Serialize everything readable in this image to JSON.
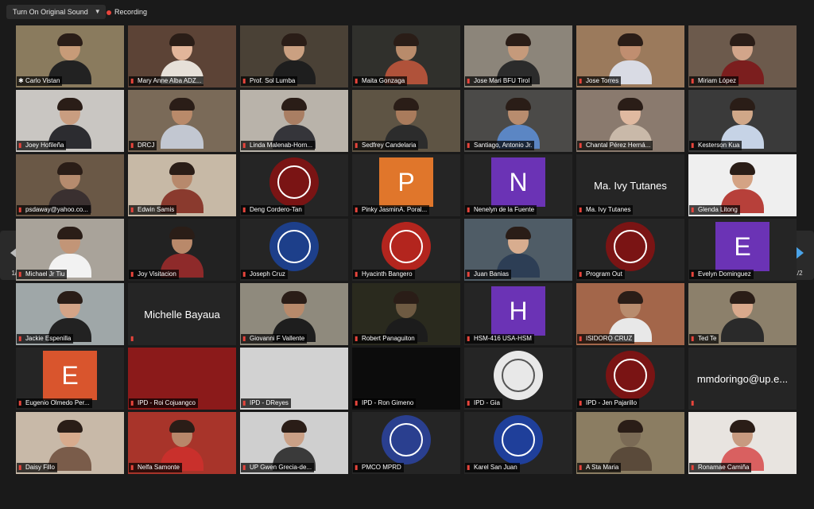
{
  "toolbar": {
    "sound_button": "Turn On Original Sound",
    "recording": "Recording"
  },
  "pager": {
    "left_page": "1/2",
    "right_page": "1/2"
  },
  "participants": [
    {
      "name": "Carlo Vistan",
      "kind": "video",
      "bg": "#8a7b5e",
      "skin": "#c79b78",
      "shirt": "#222",
      "active": true,
      "pinned": true
    },
    {
      "name": "Mary Anne Alba ADZ...",
      "kind": "video",
      "bg": "#5c4336",
      "skin": "#e2b59a",
      "shirt": "#e6e0d8"
    },
    {
      "name": "Prof. Sol Lumba",
      "kind": "video",
      "bg": "#4a4136",
      "skin": "#caa081",
      "shirt": "#1e1e1e"
    },
    {
      "name": "Maita Gonzaga",
      "kind": "video",
      "bg": "#30302c",
      "skin": "#b88b6b",
      "shirt": "#b0523a"
    },
    {
      "name": "Jose Mari BFU Tirol",
      "kind": "video",
      "bg": "#8c857a",
      "skin": "#c59a7b",
      "shirt": "#2b2b2b"
    },
    {
      "name": "Jose Torres",
      "kind": "video",
      "bg": "#9b7a5c",
      "skin": "#c08e70",
      "shirt": "#d9dbe4"
    },
    {
      "name": "Miriam López",
      "kind": "video",
      "bg": "#6c5a4c",
      "skin": "#d2a58a",
      "shirt": "#7b1e1e"
    },
    {
      "name": "Joey Hofileña",
      "kind": "video",
      "bg": "#c9c6c2",
      "skin": "#c99d80",
      "shirt": "#2c2c30"
    },
    {
      "name": "DRCJ",
      "kind": "video",
      "bg": "#7a6a58",
      "skin": "#b98a6a",
      "shirt": "#c2c7d1"
    },
    {
      "name": "Linda Malenab-Horn...",
      "kind": "video",
      "bg": "#b9b3aa",
      "skin": "#a97e63",
      "shirt": "#35353a"
    },
    {
      "name": "Sedfrey Candelaria",
      "kind": "video",
      "bg": "#5e5444",
      "skin": "#a97b5c",
      "shirt": "#2c2c2c"
    },
    {
      "name": "Santiago, Antonio Jr.",
      "kind": "video",
      "bg": "#4b4a48",
      "skin": "#b88c6e",
      "shirt": "#5b86c4"
    },
    {
      "name": "Chantal Pérez  Herná...",
      "kind": "video",
      "bg": "#8a7a6e",
      "skin": "#e0b9a0",
      "shirt": "#c9b9a9"
    },
    {
      "name": "Kesterson Kua",
      "kind": "video",
      "bg": "#3a3a3a",
      "skin": "#d0a788",
      "shirt": "#c6d3e6"
    },
    {
      "name": "psdaway@yahoo.co...",
      "kind": "video",
      "bg": "#6a5846",
      "skin": "#b58b6e",
      "shirt": "#3a3030"
    },
    {
      "name": "Edwin Samis",
      "kind": "video",
      "bg": "#c7b9a6",
      "skin": "#b7896c",
      "shirt": "#8a3a2e"
    },
    {
      "name": "Deng Cordero-Tan",
      "kind": "seal",
      "seal": "#7a1414"
    },
    {
      "name": "Pinky JasminA. Poral...",
      "kind": "letter",
      "letter": "P",
      "color": "#e0762b"
    },
    {
      "name": "Nenelyn de la Fuente",
      "kind": "letter",
      "letter": "N",
      "color": "#6b33b5"
    },
    {
      "name": "Ma. Ivy Tutanes",
      "kind": "name",
      "display": "Ma. Ivy Tutanes"
    },
    {
      "name": "Glenda Litong",
      "kind": "video",
      "bg": "#efefef",
      "skin": "#d4a384",
      "shirt": "#b7403a"
    },
    {
      "name": "Michael Jr Tiu",
      "kind": "video",
      "bg": "#a9a39a",
      "skin": "#c29577",
      "shirt": "#f2f2f2"
    },
    {
      "name": "Joy Visitacion",
      "kind": "video",
      "bg": "#222",
      "skin": "#b9896a",
      "shirt": "#8e2a2a"
    },
    {
      "name": "Joseph Cruz",
      "kind": "seal",
      "seal": "#1d3f8a"
    },
    {
      "name": "Hyacinth Bangero",
      "kind": "seal",
      "seal": "#b3251e"
    },
    {
      "name": "Juan Banias",
      "kind": "video",
      "bg": "#4f5c66",
      "skin": "#d8ad8f",
      "shirt": "#2d3e55"
    },
    {
      "name": "Program Out",
      "kind": "seal",
      "seal": "#7a1414"
    },
    {
      "name": "Evelyn Dominguez",
      "kind": "letter",
      "letter": "E",
      "color": "#6b33b5"
    },
    {
      "name": "Jackie Espenilla",
      "kind": "video",
      "bg": "#9fa7a8",
      "skin": "#d4a487",
      "shirt": "#222"
    },
    {
      "name": "Michelle Bayaua",
      "kind": "name",
      "display": "Michelle Bayaua",
      "nolabel": true
    },
    {
      "name": "Giovanni F Vallente",
      "kind": "video",
      "bg": "#8f8a7d",
      "skin": "#b88a6b",
      "shirt": "#1e1e1e"
    },
    {
      "name": "Robert Panaguiton",
      "kind": "video",
      "bg": "#2a2a1e",
      "skin": "#6e5a42",
      "shirt": "#1c1c1c"
    },
    {
      "name": "HSM-416 USA-HSM",
      "kind": "letter",
      "letter": "H",
      "color": "#6b33b5"
    },
    {
      "name": "ISIDORO CRUZ",
      "kind": "video",
      "bg": "#a3664a",
      "skin": "#b88c6e",
      "shirt": "#e8e8e8"
    },
    {
      "name": "Ted Te",
      "kind": "video",
      "bg": "#8c806b",
      "skin": "#d9a98c",
      "shirt": "#2a2a2a"
    },
    {
      "name": "Eugenio Olmedo Per...",
      "kind": "letter",
      "letter": "E",
      "color": "#d9552d"
    },
    {
      "name": "IPD - Roi Cojuangco",
      "kind": "solid",
      "color": "#8b1a1a"
    },
    {
      "name": "IPD - DReyes",
      "kind": "solid",
      "color": "#d2d2d2"
    },
    {
      "name": "IPD - Ron Gimeno",
      "kind": "solid",
      "color": "#0c0c0c"
    },
    {
      "name": "IPD - Gia",
      "kind": "seal",
      "seal": "#e8e8e8"
    },
    {
      "name": "IPD - Jen Pajarillo",
      "kind": "seal",
      "seal": "#7a1414"
    },
    {
      "name": "mmdoringo@up.e...",
      "kind": "name",
      "display": "mmdoringo@up.e...",
      "nolabel": true
    },
    {
      "name": "Daisy Fillo",
      "kind": "video",
      "bg": "#c8b9a8",
      "skin": "#d8ab8d",
      "shirt": "#7a5c4a"
    },
    {
      "name": "Nelfa Samonte",
      "kind": "video",
      "bg": "#a8342a",
      "skin": "#b8876a",
      "shirt": "#c9302c"
    },
    {
      "name": "UP Gwen Grecia-de...",
      "kind": "video",
      "bg": "#cfcfcf",
      "skin": "#caa086",
      "shirt": "#3a3a3a"
    },
    {
      "name": "PMCO MPRD",
      "kind": "seal",
      "seal": "#2a3f8f"
    },
    {
      "name": "Karel San Juan",
      "kind": "seal",
      "seal": "#1f3f9a"
    },
    {
      "name": "A Sta Maria",
      "kind": "video",
      "bg": "#8b7d62",
      "skin": "#7a6a55",
      "shirt": "#5a4a3a"
    },
    {
      "name": "Ronamae Camiña",
      "kind": "video",
      "bg": "#e8e4e0",
      "skin": "#c79a80",
      "shirt": "#d96060"
    }
  ]
}
